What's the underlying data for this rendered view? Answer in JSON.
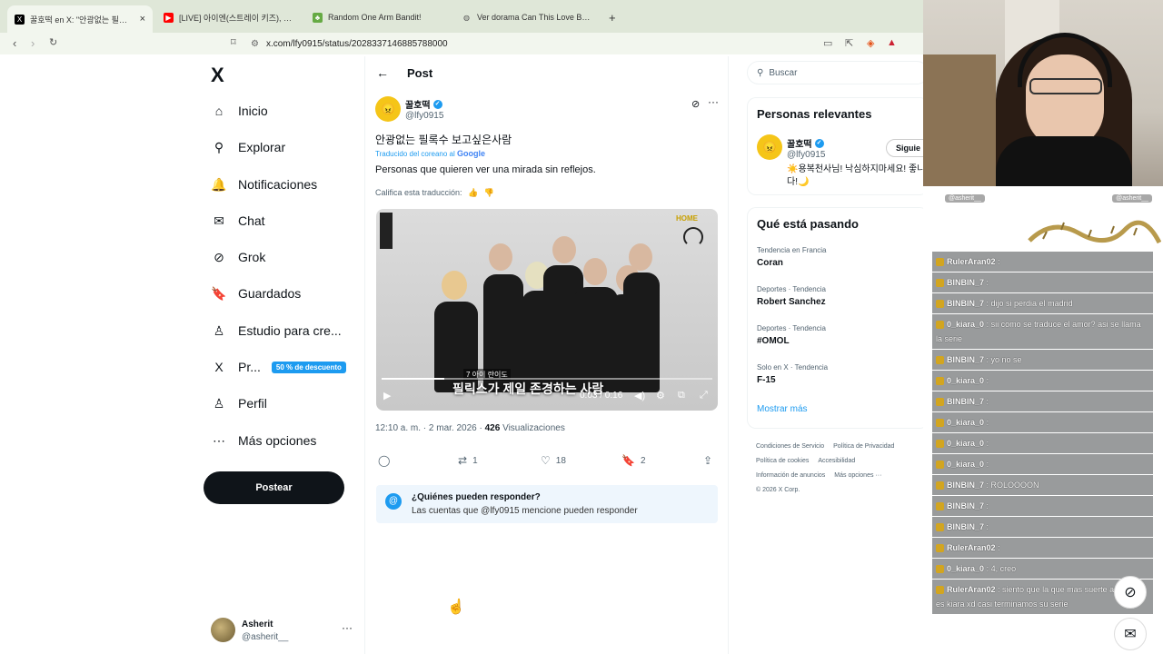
{
  "browser": {
    "tabs": [
      {
        "title": "꿀호떡 en X: \"안광없는 필록수 보",
        "icon": "x-logo-icon"
      },
      {
        "title": "[LIVE] 아이엔(스트레이 키즈), \"인천",
        "icon": "youtube-icon"
      },
      {
        "title": "Random One Arm Bandit!",
        "icon": "slot-icon"
      },
      {
        "title": "Ver dorama Can This Love Be Transl",
        "icon": "globe-icon"
      }
    ],
    "new_tab": "+",
    "url": "x.com/lfy0915/status/2028337146885788000"
  },
  "nav": {
    "logo": "X",
    "items": [
      {
        "label": "Inicio",
        "icon": "⌂"
      },
      {
        "label": "Explorar",
        "icon": "⚲"
      },
      {
        "label": "Notificaciones",
        "icon": "🔔"
      },
      {
        "label": "Chat",
        "icon": "✉"
      },
      {
        "label": "Grok",
        "icon": "⊘"
      },
      {
        "label": "Guardados",
        "icon": "🔖"
      },
      {
        "label": "Estudio para cre...",
        "icon": "♙"
      },
      {
        "label": "Pr...",
        "icon": "X"
      },
      {
        "label": "Perfil",
        "icon": "♙"
      },
      {
        "label": "Más opciones",
        "icon": "⋯"
      }
    ],
    "promo_badge": "50 % de descuento",
    "post_button": "Postear",
    "account": {
      "name": "Asherit",
      "handle": "@asherit__",
      "more": "···"
    }
  },
  "post": {
    "header": "Post",
    "author_name": "꿀호떡",
    "author_handle": "@lfy0915",
    "original_text": "안광없는 필록수 보고싶은사람",
    "translated_from": "Traducido del coreano al",
    "translator": "Google",
    "translated_text": "Personas que quieren ver una mirada sin reflejos.",
    "rate_translation": "Califica esta traducción:",
    "video": {
      "brand_tag": "HOME",
      "caption_small": "7 아이 란이도",
      "caption": "필릭스가 제일 존경하는 사람",
      "time": "0:03 / 0:16",
      "progress": 0.19
    },
    "time": "12:10 a. m.",
    "date": "2 mar. 2026",
    "views": "426",
    "views_label": "Visualizaciones",
    "retweets": "1",
    "likes": "18",
    "bookmarks": "2",
    "reply_title": "¿Quiénes pueden responder?",
    "reply_text": "Las cuentas que @lfy0915 mencione pueden responder"
  },
  "sidebar": {
    "search_placeholder": "Buscar",
    "relevant_title": "Personas relevantes",
    "relevant_name": "꿀호떡",
    "relevant_handle": "@lfy0915",
    "relevant_bio": "☀️용복천사님! 낙심하지마세요! 좋니다!🌙",
    "follow": "Siguie",
    "trending_title": "Qué está pasando",
    "trends": [
      {
        "context": "Tendencia en Francia",
        "topic": "Coran"
      },
      {
        "context": "Deportes · Tendencia",
        "topic": "Robert Sanchez"
      },
      {
        "context": "Deportes · Tendencia",
        "topic": "#OMOL"
      },
      {
        "context": "Solo en X · Tendencia",
        "topic": "F-15"
      }
    ],
    "show_more": "Mostrar más",
    "footer": [
      "Condiciones de Servicio",
      "Política de Privacidad",
      "Política de cookies",
      "Accesibilidad",
      "Información de anuncios",
      "Más opciones ···",
      "© 2026 X Corp."
    ]
  },
  "stream": {
    "header_left": "@asherit__",
    "header_right": "@asherit__",
    "chat": [
      {
        "user": "RulerAran02",
        "text": ":"
      },
      {
        "user": "BINBIN_7",
        "text": ":"
      },
      {
        "user": "BINBIN_7",
        "text": ": dijo si perdia el madrid"
      },
      {
        "user": "0_kiara_0",
        "text": ": sii como se traduce el amor? asi se llama la serie"
      },
      {
        "user": "BINBIN_7",
        "text": ": yo no se"
      },
      {
        "user": "0_kiara_0",
        "text": ":"
      },
      {
        "user": "BINBIN_7",
        "text": ":"
      },
      {
        "user": "0_kiara_0",
        "text": ":"
      },
      {
        "user": "0_kiara_0",
        "text": ":"
      },
      {
        "user": "0_kiara_0",
        "text": ":"
      },
      {
        "user": "BINBIN_7",
        "text": ": ROLOOOON"
      },
      {
        "user": "BINBIN_7",
        "text": ":"
      },
      {
        "user": "BINBIN_7",
        "text": ":"
      },
      {
        "user": "RulerAran02",
        "text": ":"
      },
      {
        "user": "0_kiara_0",
        "text": ": 4, creo"
      },
      {
        "user": "RulerAran02",
        "text": ": siento que la que mas suerte a tenido es kiara xd casi terminamos su serie"
      }
    ]
  }
}
